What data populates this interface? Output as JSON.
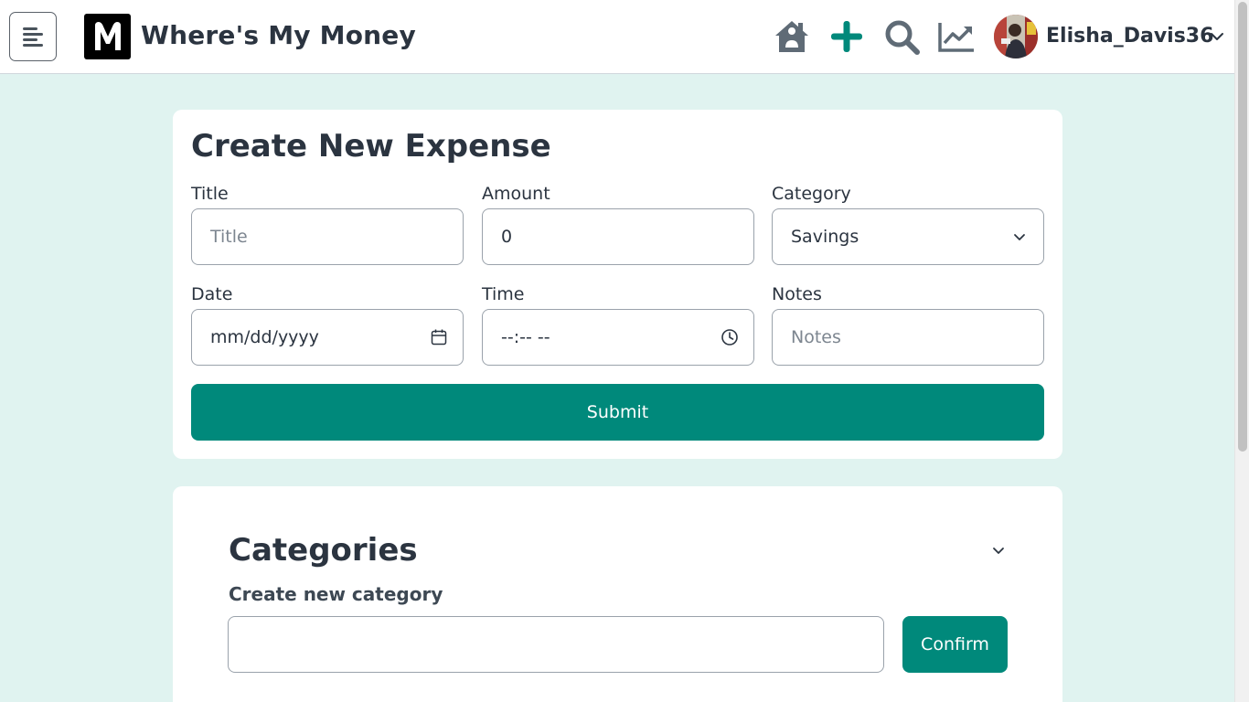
{
  "header": {
    "app_title": "Where's My Money",
    "logo_letter": "M",
    "username": "Elisha_Davis36",
    "icons": [
      "menu-icon",
      "home-icon",
      "plus-icon",
      "search-icon",
      "trending-up-icon",
      "chevron-down-icon"
    ]
  },
  "expense_form": {
    "title": "Create New Expense",
    "title_label": "Title",
    "title_placeholder": "Title",
    "amount_label": "Amount",
    "amount_value": "0",
    "category_label": "Category",
    "category_selected": "Savings",
    "date_label": "Date",
    "date_placeholder": "mm/dd/yyyy",
    "time_label": "Time",
    "time_placeholder": "--:-- --",
    "notes_label": "Notes",
    "notes_placeholder": "Notes",
    "submit_label": "Submit"
  },
  "categories": {
    "title": "Categories",
    "create_label": "Create new category",
    "input_value": "",
    "confirm_label": "Confirm"
  },
  "colors": {
    "accent": "#00897b",
    "page_background": "#e0f3f0",
    "text": "#2b3440",
    "icon_gray": "#5f6b76"
  }
}
